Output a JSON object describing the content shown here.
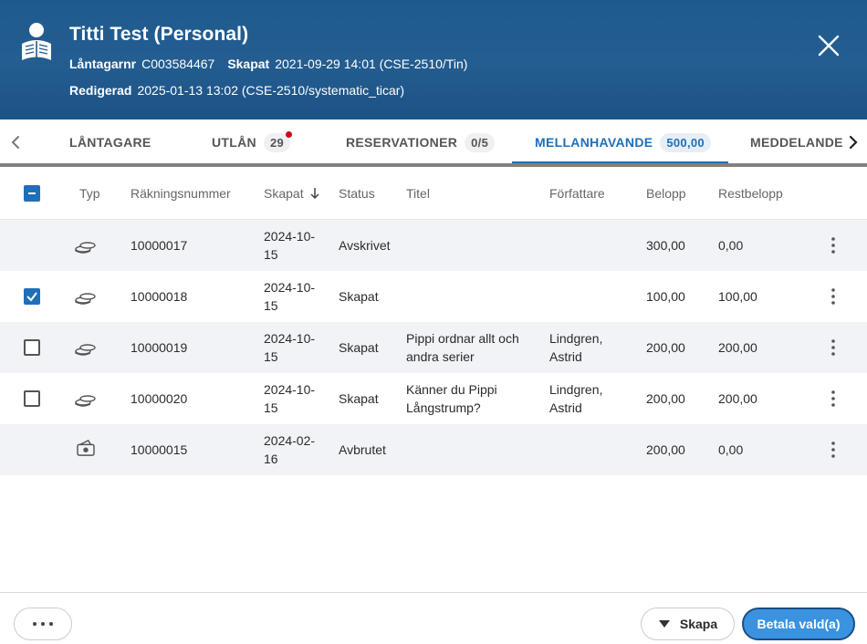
{
  "header": {
    "title": "Titti Test (Personal)",
    "borrower_no_label": "Låntagarnr",
    "borrower_no": "C003584467",
    "created_label": "Skapat",
    "created_value": "2021-09-29 14:01 (CSE-2510/Tin)",
    "edited_label": "Redigerad",
    "edited_value": "2025-01-13 13:02 (CSE-2510/systematic_ticar)"
  },
  "tabs": [
    {
      "label": "LÅNTAGARE",
      "count": ""
    },
    {
      "label": "UTLÅN",
      "count": "29"
    },
    {
      "label": "RESERVATIONER",
      "count": "0/5"
    },
    {
      "label": "MELLANHAVANDE",
      "count": "500,00"
    },
    {
      "label": "MEDDELANDE",
      "count": ""
    }
  ],
  "table": {
    "headers": {
      "type": "Typ",
      "number": "Räkningsnummer",
      "created": "Skapat",
      "status": "Status",
      "title": "Titel",
      "author": "Författare",
      "amount": "Belopp",
      "remaining": "Restbelopp"
    },
    "rows": [
      {
        "number": "10000017",
        "created1": "2024-10-",
        "created2": "15",
        "status": "Avskrivet",
        "title1": "",
        "title2": "",
        "author1": "",
        "author2": "",
        "amount": "300,00",
        "remaining": "0,00"
      },
      {
        "number": "10000018",
        "created1": "2024-10-",
        "created2": "15",
        "status": "Skapat",
        "title1": "",
        "title2": "",
        "author1": "",
        "author2": "",
        "amount": "100,00",
        "remaining": "100,00"
      },
      {
        "number": "10000019",
        "created1": "2024-10-",
        "created2": "15",
        "status": "Skapat",
        "title1": "Pippi ordnar allt och",
        "title2": "andra serier",
        "author1": "Lindgren,",
        "author2": "Astrid",
        "amount": "200,00",
        "remaining": "200,00"
      },
      {
        "number": "10000020",
        "created1": "2024-10-",
        "created2": "15",
        "status": "Skapat",
        "title1": "Känner du Pippi",
        "title2": "Långstrump?",
        "author1": "Lindgren,",
        "author2": "Astrid",
        "amount": "200,00",
        "remaining": "200,00"
      },
      {
        "number": "10000015",
        "created1": "2024-02-",
        "created2": "16",
        "status": "Avbrutet",
        "title1": "",
        "title2": "",
        "author1": "",
        "author2": "",
        "amount": "200,00",
        "remaining": "0,00"
      }
    ]
  },
  "footer": {
    "create_label": "Skapa",
    "pay_label": "Betala vald(a)"
  },
  "colors": {
    "header_bg": "#1f5a8e",
    "accent": "#1f6fb8",
    "pay_button": "#3b93df",
    "notification_dot": "#d0021b"
  }
}
